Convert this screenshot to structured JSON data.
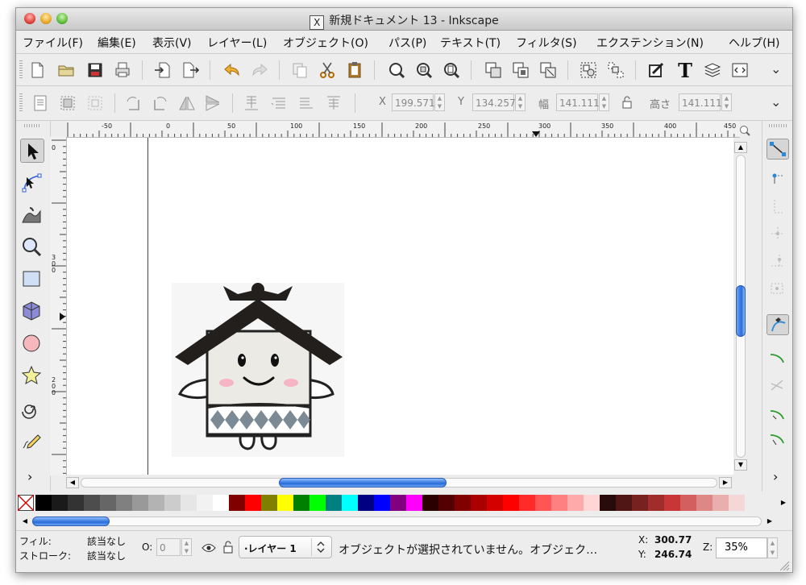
{
  "window": {
    "title": "新規ドキュメント 13 - Inkscape",
    "title_icon": "X"
  },
  "menus": [
    "ファイル(F)",
    "編集(E)",
    "表示(V)",
    "レイヤー(L)",
    "オブジェクト(O)",
    "パス(P)",
    "テキスト(T)",
    "フィルタ(S)",
    "エクステンション(N)",
    "ヘルプ(H)"
  ],
  "commands_toolbar": {
    "icons": [
      "new-document-icon",
      "open-folder-icon",
      "save-icon",
      "print-icon",
      "import-icon",
      "export-icon",
      "undo-icon",
      "redo-icon",
      "copy-icon",
      "cut-icon",
      "paste-icon",
      "zoom-selection-icon",
      "zoom-drawing-icon",
      "zoom-page-icon",
      "duplicate-icon",
      "clone-icon",
      "unlink-clone-icon",
      "group-icon",
      "ungroup-icon",
      "fill-stroke-icon",
      "text-font-icon",
      "layers-icon",
      "xml-editor-icon"
    ],
    "text_tool_glyph": "T",
    "overflow": "⌄"
  },
  "controls_toolbar": {
    "x_label": "X",
    "x_value": "199.571",
    "y_label": "Y",
    "y_value": "134.257",
    "w_label": "幅",
    "w_value": "141.111",
    "h_label": "高さ",
    "h_value": "141.111",
    "overflow": "⌄"
  },
  "ruler": {
    "h_labels": [
      "-50",
      "0",
      "50",
      "100",
      "150",
      "200",
      "250",
      "300",
      "350",
      "400",
      "450"
    ],
    "v_labels": [
      "0",
      "3\n0\n0",
      "2\n0\n0"
    ]
  },
  "tools": [
    "selector-tool-icon",
    "node-tool-icon",
    "tweak-tool-icon",
    "zoom-tool-icon",
    "rectangle-tool-icon",
    "3d-box-tool-icon",
    "ellipse-tool-icon",
    "star-tool-icon",
    "spiral-tool-icon",
    "pencil-tool-icon"
  ],
  "toolbox_more": "›",
  "snapbar_more": "›",
  "status": {
    "fill_label": "フィル:",
    "fill_value": "該当なし",
    "stroke_label": "ストローク:",
    "stroke_value": "該当なし",
    "opacity_label": "O:",
    "opacity_value": "0",
    "layer": "·レイヤー 1",
    "message": "オブジェクトが選択されていません。オブジェク…",
    "x_label": "X:",
    "x_value": "300.77",
    "y_label": "Y:",
    "y_value": "246.74",
    "zoom_label": "Z:",
    "zoom_value": "35%"
  },
  "palette": [
    "#000000",
    "#1a1a1a",
    "#333333",
    "#4d4d4d",
    "#666666",
    "#808080",
    "#999999",
    "#b3b3b3",
    "#cccccc",
    "#e6e6e6",
    "#f2f2f2",
    "#ffffff",
    "#800000",
    "#ff0000",
    "#808000",
    "#ffff00",
    "#008000",
    "#00ff00",
    "#008080",
    "#00ffff",
    "#000080",
    "#0000ff",
    "#800080",
    "#ff00ff",
    "#2b0000",
    "#550000",
    "#800000",
    "#aa0000",
    "#d40000",
    "#ff0000",
    "#ff2a2a",
    "#ff5555",
    "#ff8080",
    "#ffaaaa",
    "#ffd5d5",
    "#280b0b",
    "#501616",
    "#782121",
    "#a02c2c",
    "#c83737",
    "#d35f5f",
    "#de8787",
    "#e9afaf",
    "#f4d7d7"
  ]
}
